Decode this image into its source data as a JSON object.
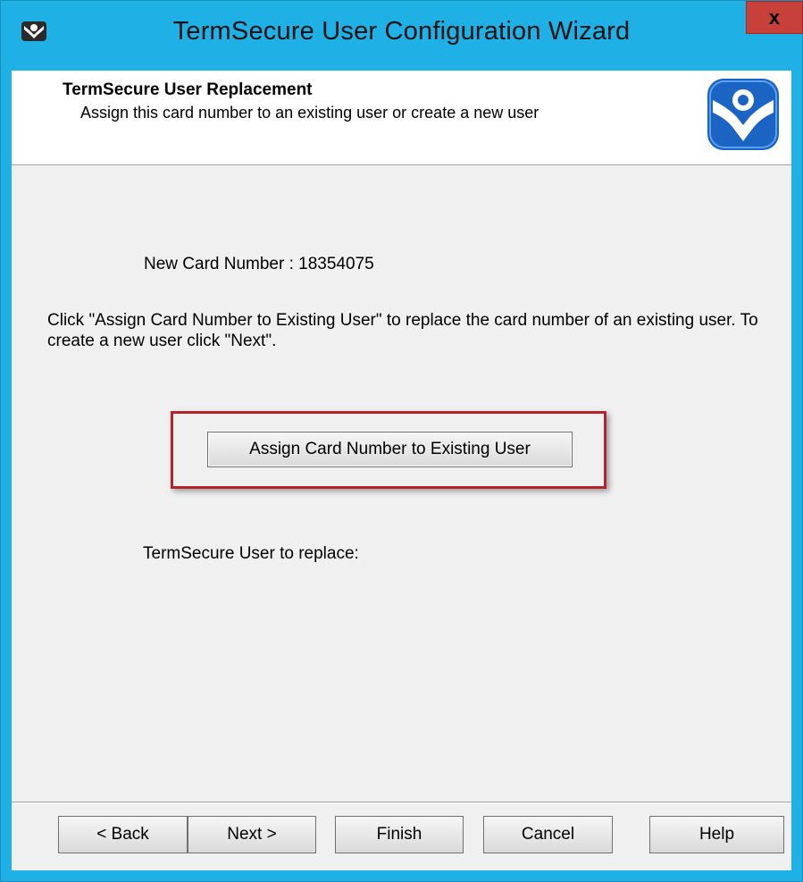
{
  "window": {
    "title": "TermSecure User Configuration Wizard",
    "close_label": "x"
  },
  "header": {
    "title": "TermSecure User Replacement",
    "subtitle": "Assign this card number to an existing user or create a new user"
  },
  "content": {
    "card_number_text": "New Card Number : 18354075",
    "instructions": "Click \"Assign Card Number to Existing User\" to replace the card number  of an existing user. To create a new user click \"Next\".",
    "assign_button_label": "Assign Card Number to Existing User",
    "replace_label": "TermSecure User to replace:"
  },
  "buttons": {
    "back": "< Back",
    "next": "Next >",
    "finish": "Finish",
    "cancel": "Cancel",
    "help": "Help"
  },
  "colors": {
    "titlebar": "#1fb1e5",
    "close_button": "#c7413a",
    "highlight_border": "#b1262a",
    "logo_blue": "#1b64c4"
  },
  "icons": {
    "app_icon": "termsecure-app-icon",
    "header_logo": "thinmanager-logo-icon"
  }
}
